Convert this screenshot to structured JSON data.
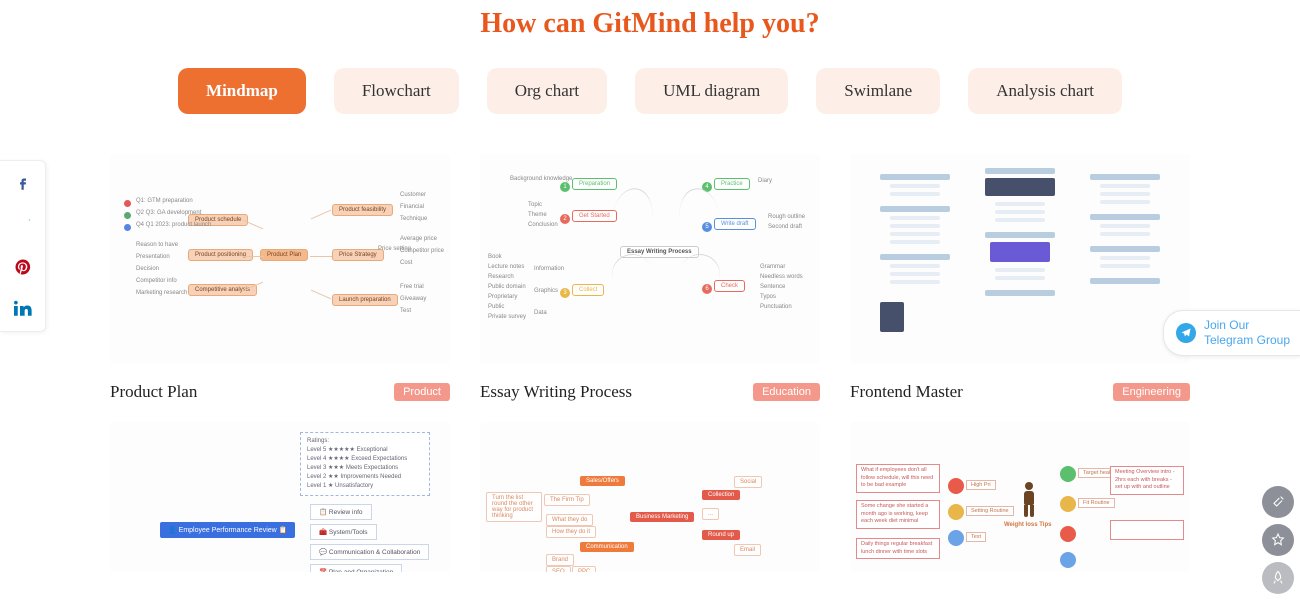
{
  "heading": "How can GitMind help you?",
  "tabs": [
    {
      "label": "Mindmap",
      "active": true
    },
    {
      "label": "Flowchart",
      "active": false
    },
    {
      "label": "Org chart",
      "active": false
    },
    {
      "label": "UML diagram",
      "active": false
    },
    {
      "label": "Swimlane",
      "active": false
    },
    {
      "label": "Analysis chart",
      "active": false
    }
  ],
  "cards": {
    "row1": [
      {
        "title": "Product Plan",
        "badge": "Product"
      },
      {
        "title": "Essay Writing Process",
        "badge": "Education"
      },
      {
        "title": "Frontend Master",
        "badge": "Engineering"
      }
    ]
  },
  "thumb1": {
    "center": "Product Plan",
    "top_branches": [
      "Product schedule",
      "Product positioning",
      "Competitive analysis"
    ],
    "right_branches": [
      "Product feasibility",
      "Price Strategy",
      "Launch preparation"
    ],
    "right_leaves_a": [
      "Customer",
      "Financial",
      "Technique"
    ],
    "right_leaves_b": [
      "Average price",
      "Competitor price",
      "Cost"
    ],
    "right_leaves_c": [
      "Free trial",
      "Giveaway",
      "Test"
    ],
    "left_dots": [
      {
        "label": "Q1: GTM preparation",
        "color": "#e25757"
      },
      {
        "label": "Q2 Q3: GA development",
        "color": "#5aa971"
      },
      {
        "label": "Q4 Q1 2023: product launch",
        "color": "#5785e2"
      }
    ],
    "left_leaves": [
      "Reason to have",
      "Presentation",
      "Decision",
      "Competitor info",
      "Marketing research"
    ],
    "price_sub": "Price setting"
  },
  "thumb2": {
    "center": "Essay Writing Process",
    "steps": [
      {
        "n": "1",
        "label": "Preparation",
        "color": "#5bbf6e"
      },
      {
        "n": "2",
        "label": "Get Started",
        "color": "#e86a5e"
      },
      {
        "n": "3",
        "label": "Collect",
        "color": "#e9b64a"
      },
      {
        "n": "4",
        "label": "Practice",
        "color": "#5bbf6e"
      },
      {
        "n": "5",
        "label": "Write draft",
        "color": "#5a8fe0"
      },
      {
        "n": "6",
        "label": "Check",
        "color": "#e86a5e"
      }
    ],
    "leaves_prep": [
      "Background knowledge"
    ],
    "leaves_start": [
      "Topic",
      "Theme",
      "Conclusion"
    ],
    "leaves_collect_l": [
      "Book",
      "Lecture notes",
      "Research",
      "Public domain",
      "Proprietary",
      "Public",
      "Private survey"
    ],
    "leaves_collect_r": [
      "Information",
      "Graphics",
      "Data"
    ],
    "leaves_practice": [
      "Diary"
    ],
    "leaves_draft": [
      "Rough outline",
      "Second draft"
    ],
    "leaves_check": [
      "Grammar",
      "Needless words",
      "Sentence",
      "Typos",
      "Punctuation"
    ]
  },
  "thumb4": {
    "blue": "👤 Employee Performance Review 📋",
    "ratings": [
      "Ratings:",
      "Level 5 ★★★★★ Exceptional",
      "Level 4 ★★★★ Exceed Expectations",
      "Level 3 ★★★ Meets Expectations",
      "Level 2 ★★ Improvements Needed",
      "Level 1 ★ Unsatisfactory"
    ],
    "boxes": [
      "📋 Review info",
      "🧰 System/Tools",
      "💬 Communication & Collaboration",
      "📅 Plan and Organization"
    ]
  },
  "thumb5": {
    "center": "Business Marketing",
    "top": [
      "Sales/Offers"
    ],
    "left": [
      "Communication"
    ],
    "pale": [
      "What they do",
      "How they do it",
      "Brand",
      "SEO",
      "PPC",
      "Social",
      "Email"
    ],
    "red": [
      "Collection",
      "Round up"
    ],
    "note1": "Turn the list round the other way for product thinking",
    "note2": "The Firm Tip"
  },
  "thumb6": {
    "center": "Weight loss Tips",
    "dots": [
      {
        "label": "High Pri",
        "color": "#e85a4a"
      },
      {
        "label": "Setting Routine",
        "color": "#e9b64a"
      },
      {
        "label": "Text",
        "color": "#6aa3e6"
      }
    ],
    "right_dots": [
      {
        "color": "#5bbf6e",
        "label": "Target health tips"
      },
      {
        "color": "#e9b64a",
        "label": "Fit Routine"
      },
      {
        "color": "#e85a4a",
        "label": ""
      },
      {
        "color": "#6aa3e6",
        "label": ""
      }
    ],
    "notes": [
      "What if employees don't all follow schedule, will this need to be bad example",
      "Some change she started a month ago is working, keep each week diet minimal",
      "Daily things regular breakfast lunch dinner with time slots",
      "Meeting Overview intro - 2hrs each with breaks - set up with and outline"
    ]
  },
  "telegram": {
    "line1": "Join Our",
    "line2": "Telegram Group"
  }
}
